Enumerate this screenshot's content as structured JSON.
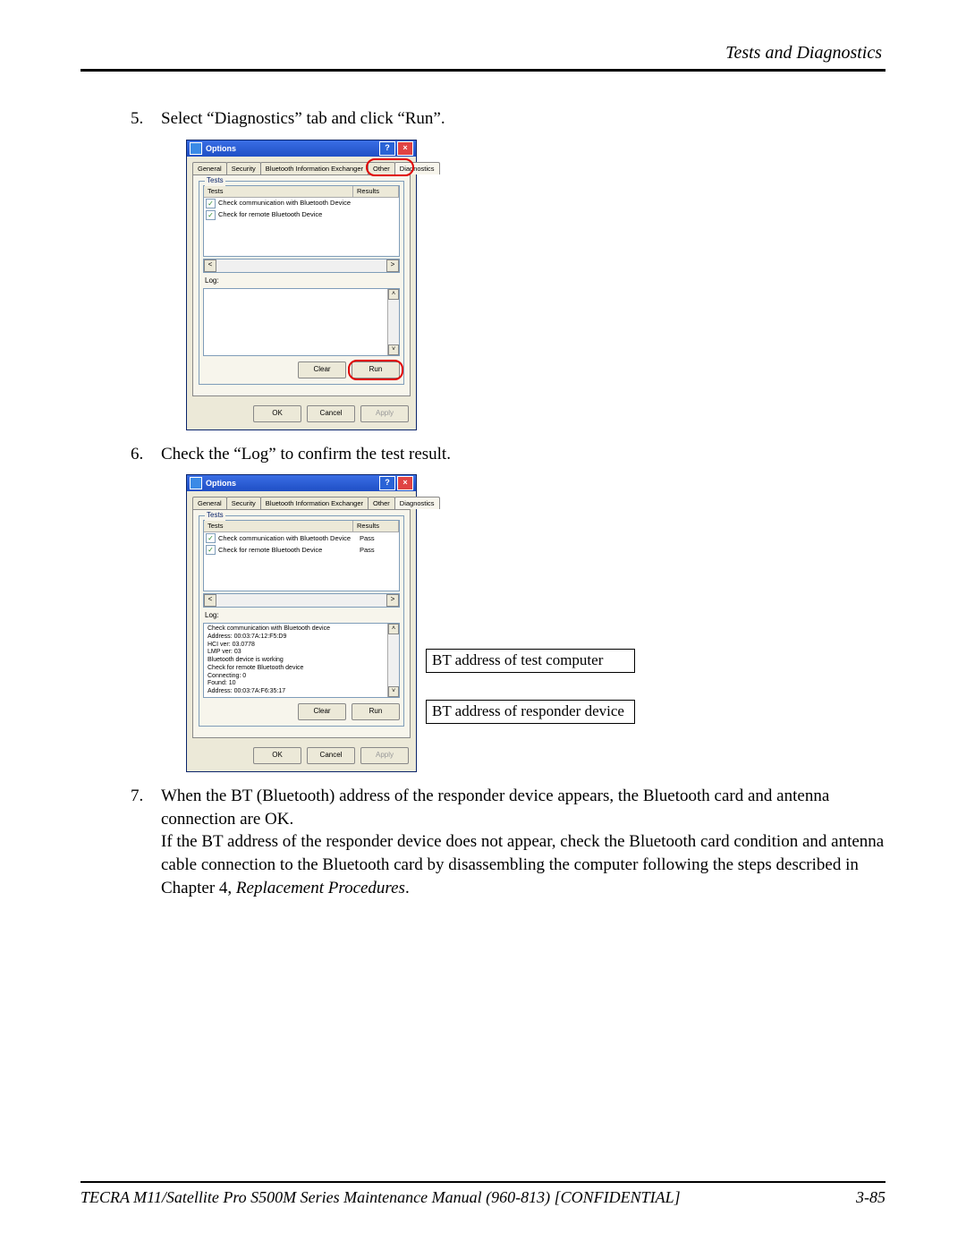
{
  "header": {
    "section": "Tests and Diagnostics"
  },
  "steps": {
    "s5": {
      "num": "5.",
      "text": "Select “Diagnostics” tab and click “Run”."
    },
    "s6": {
      "num": "6.",
      "text": "Check the “Log” to confirm the test result."
    },
    "s7": {
      "num": "7.",
      "text_a": "When the BT (Bluetooth) address of the responder device appears, the Bluetooth card and antenna connection are OK.",
      "text_b": "If the BT address of the responder device does not appear, check the Bluetooth card condition and antenna cable connection to the Bluetooth card by disassembling the computer following the steps described in Chapter 4, ",
      "text_c_italic": "Replacement Procedures",
      "text_c_tail": "."
    }
  },
  "dialog": {
    "title": "Options",
    "help_icon": "?",
    "close_icon": "×",
    "tabs": {
      "general": "General",
      "security": "Security",
      "bie": "Bluetooth Information Exchanger",
      "other": "Other",
      "diagnostics": "Diagnostics"
    },
    "fieldset": {
      "legend": "Tests"
    },
    "columns": {
      "tests": "Tests",
      "results": "Results"
    },
    "tests": [
      {
        "label": "Check communication with Bluetooth Device",
        "result_1": "",
        "result_2": "Pass"
      },
      {
        "label": "Check for remote Bluetooth Device",
        "result_1": "",
        "result_2": "Pass"
      }
    ],
    "loglabel": "Log:",
    "log_lines": [
      "Check communication with Bluetooth device",
      "Address: 00:03:7A:12:F5:D9",
      "HCI ver: 03.0778",
      "LMP ver: 03",
      "Bluetooth device is working",
      "Check for remote Bluetooth device",
      "Connecting: 0",
      "Found: 10",
      "Address: 00:03:7A:F6:35:17"
    ],
    "buttons": {
      "clear": "Clear",
      "run": "Run",
      "ok": "OK",
      "cancel": "Cancel",
      "apply": "Apply"
    }
  },
  "callouts": {
    "test_addr": "BT address of test computer",
    "responder_addr": "BT address of responder device"
  },
  "footer": {
    "manual": "TECRA M11/Satellite Pro S500M Series Maintenance Manual (960-813) [CONFIDENTIAL]",
    "page": "3-85"
  }
}
